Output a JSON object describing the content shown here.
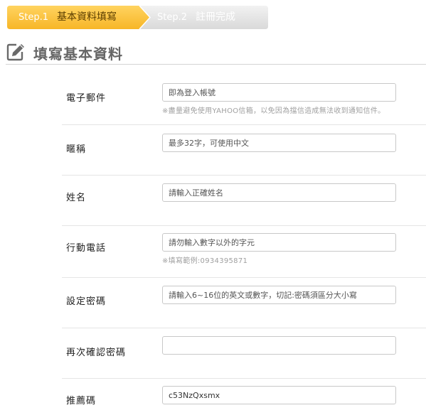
{
  "steps": [
    {
      "num": "Step.1",
      "name": "基本資料填寫",
      "state": "active"
    },
    {
      "num": "Step.2",
      "name": "註冊完成",
      "state": "inactive"
    }
  ],
  "section": {
    "title": "填寫基本資料",
    "icon": "pencil-edit-icon"
  },
  "form": {
    "email": {
      "label": "電子郵件",
      "placeholder": "即為登入帳號",
      "hint": "※盡量避免使用YAHOO信箱，以免因為擋信造成無法收到通知信件。"
    },
    "nickname": {
      "label": "暱稱",
      "placeholder": "最多32字，可使用中文"
    },
    "name": {
      "label": "姓名",
      "placeholder": "請輸入正確姓名"
    },
    "phone": {
      "label": "行動電話",
      "placeholder": "請勿輸入數字以外的字元",
      "hint": "※填寫範例:0934395871"
    },
    "password": {
      "label": "設定密碼",
      "placeholder": "請輸入6~16位的英文或數字，切記:密碼須區分大小寫"
    },
    "password_confirm": {
      "label": "再次確認密碼",
      "placeholder": ""
    },
    "referral": {
      "label": "推薦碼",
      "value": "c53NzQxsmx"
    }
  },
  "colors": {
    "step_active": "#ffc43a",
    "step_inactive": "#e6e6e6",
    "section_title": "#666666"
  }
}
